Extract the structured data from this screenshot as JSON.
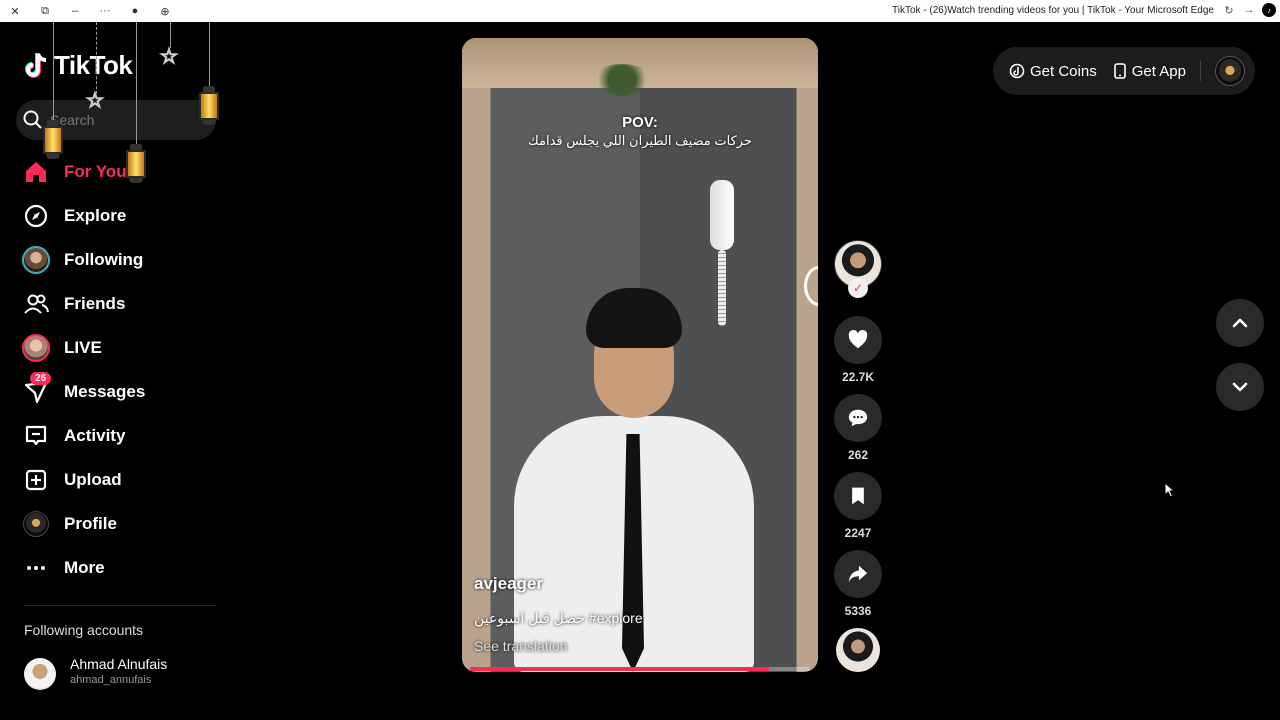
{
  "browser": {
    "title": "TikTok - (26)Watch trending videos for you | TikTok - Your Microsoft Edge"
  },
  "sidebar": {
    "logo_text": "TikTok",
    "search_placeholder": "Search",
    "items": [
      {
        "label": "For You",
        "icon": "home-icon",
        "active": true
      },
      {
        "label": "Explore",
        "icon": "compass-icon"
      },
      {
        "label": "Following",
        "icon": "following-avatar"
      },
      {
        "label": "Friends",
        "icon": "friends-icon"
      },
      {
        "label": "LIVE",
        "icon": "live-avatar"
      },
      {
        "label": "Messages",
        "icon": "messages-icon",
        "badge": "26"
      },
      {
        "label": "Activity",
        "icon": "activity-icon"
      },
      {
        "label": "Upload",
        "icon": "upload-icon"
      },
      {
        "label": "Profile",
        "icon": "profile-avatar"
      },
      {
        "label": "More",
        "icon": "more-icon"
      }
    ],
    "following_title": "Following accounts",
    "following": [
      {
        "name": "Ahmad Alnufais",
        "handle": "ahmad_annufais"
      }
    ]
  },
  "video": {
    "caption_title": "POV:",
    "caption_arabic": "حركات مضيف الطيران اللي يجلس قدامك",
    "username": "avjeager",
    "description": "حصل قبل اسبوعين #explore",
    "see_translation": "See translation",
    "progress": 0.88
  },
  "actions": {
    "likes": "22.7K",
    "comments": "262",
    "saves": "2247",
    "shares": "5336"
  },
  "topbar": {
    "get_coins": "Get Coins",
    "get_app": "Get App"
  },
  "colors": {
    "accent": "#fe2c55",
    "background": "#000000",
    "surface": "#2a2a2a"
  }
}
